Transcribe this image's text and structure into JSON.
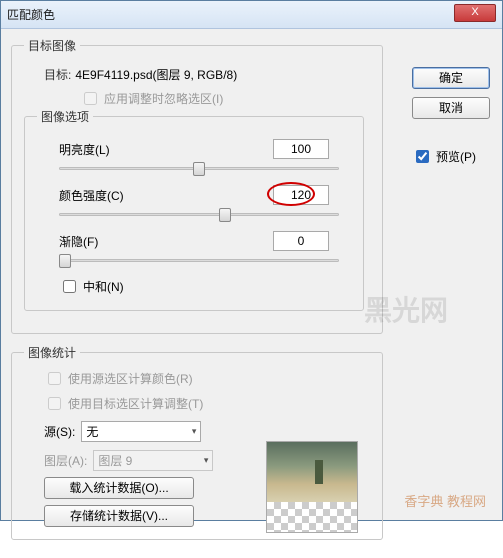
{
  "window": {
    "title": "匹配颜色"
  },
  "buttons": {
    "ok": "确定",
    "cancel": "取消",
    "close": "X"
  },
  "preview": {
    "label": "预览(P)",
    "checked": true
  },
  "target_image": {
    "legend": "目标图像",
    "target_label": "目标:",
    "target_value": "4E9F4119.psd(图层 9, RGB/8)",
    "ignore_selection": "应用调整时忽略选区(I)"
  },
  "image_options": {
    "legend": "图像选项",
    "luminance": {
      "label": "明亮度(L)",
      "value": "100"
    },
    "intensity": {
      "label": "颜色强度(C)",
      "value": "120"
    },
    "fade": {
      "label": "渐隐(F)",
      "value": "0"
    },
    "neutralize": "中和(N)"
  },
  "stats": {
    "legend": "图像统计",
    "use_src_sel": "使用源选区计算颜色(R)",
    "use_tgt_sel": "使用目标选区计算调整(T)",
    "source_label": "源(S):",
    "source_value": "无",
    "layer_label": "图层(A):",
    "layer_value": "图层 9",
    "load": "载入统计数据(O)...",
    "save": "存储统计数据(V)..."
  },
  "watermarks": {
    "main": "黑光网",
    "corner": "香字典 教程网"
  }
}
